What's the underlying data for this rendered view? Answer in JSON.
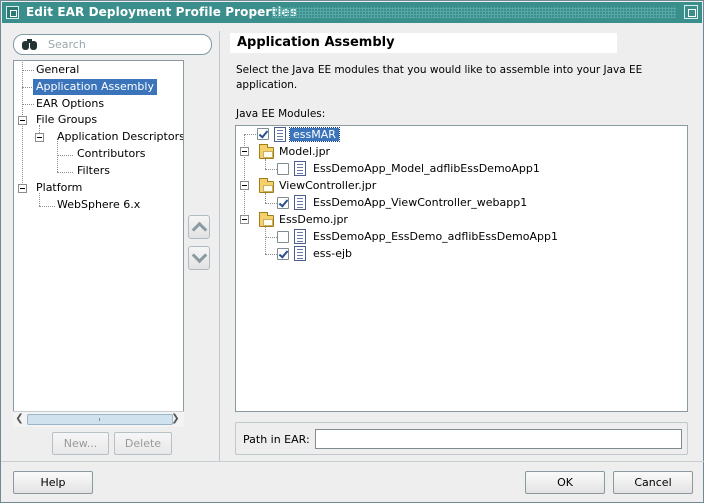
{
  "window": {
    "title": "Edit EAR Deployment Profile Properties"
  },
  "search": {
    "placeholder": "Search"
  },
  "nav": {
    "items": [
      {
        "label": "General"
      },
      {
        "label": "Application Assembly",
        "selected": true
      },
      {
        "label": "EAR Options"
      },
      {
        "label": "File Groups"
      },
      {
        "label": "Application Descriptors"
      },
      {
        "label": "Contributors"
      },
      {
        "label": "Filters"
      },
      {
        "label": "Platform"
      },
      {
        "label": "WebSphere 6.x"
      }
    ],
    "new_label": "New...",
    "delete_label": "Delete"
  },
  "main": {
    "title": "Application Assembly",
    "description": "Select the Java EE modules that you would like to assemble into your Java EE application.",
    "modules_label": "Java EE Modules:",
    "modules": [
      {
        "label": "essMAR",
        "checked": true,
        "kind": "document-icon",
        "selected": true
      },
      {
        "label": "Model.jpr",
        "kind": "folder-icon"
      },
      {
        "label": "EssDemoApp_Model_adflibEssDemoApp1",
        "checked": false,
        "kind": "document-icon"
      },
      {
        "label": "ViewController.jpr",
        "kind": "folder-icon"
      },
      {
        "label": "EssDemoApp_ViewController_webapp1",
        "checked": true,
        "kind": "document-icon"
      },
      {
        "label": "EssDemo.jpr",
        "kind": "folder-icon"
      },
      {
        "label": "EssDemoApp_EssDemo_adflibEssDemoApp1",
        "checked": false,
        "kind": "document-icon"
      },
      {
        "label": "ess-ejb",
        "checked": true,
        "kind": "document-icon"
      }
    ],
    "path_label": "Path in EAR:",
    "path_value": ""
  },
  "footer": {
    "help_label": "Help",
    "ok_label": "OK",
    "cancel_label": "Cancel"
  },
  "colors": {
    "titlebar": "#3a8e8c",
    "selection": "#3b74ba"
  }
}
